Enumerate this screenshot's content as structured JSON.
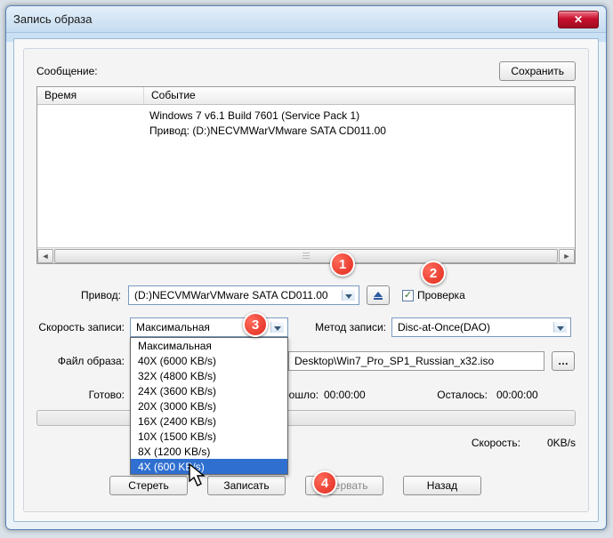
{
  "window": {
    "title": "Запись образа"
  },
  "labels": {
    "message": "Сообщение:",
    "drive": "Привод:",
    "speed": "Скорость записи:",
    "method": "Метод записи:",
    "image_file": "Файл образа:",
    "ready": "Готово:",
    "elapsed": "рошло:",
    "remaining": "Осталось:",
    "speed_stat": "Скорость:",
    "verify": "Проверка"
  },
  "buttons": {
    "save": "Сохранить",
    "erase": "Стереть",
    "burn": "Записать",
    "abort": "Прервать",
    "back": "Назад"
  },
  "columns": {
    "time": "Время",
    "event": "Событие"
  },
  "events": [
    "Windows 7 v6.1 Build 7601 (Service Pack 1)",
    "Привод: (D:)NECVMWarVMware SATA CD011.00"
  ],
  "drive_value": "(D:)NECVMWarVMware SATA CD011.00",
  "speed_value": "Максимальная",
  "method_value": "Disc-at-Once(DAO)",
  "image_value": "Desktop\\Win7_Pro_SP1_Russian_x32.iso",
  "elapsed_value": "00:00:00",
  "remaining_value": "00:00:00",
  "speed_stat_value": "0KB/s",
  "speed_options": [
    "Максимальная",
    "40X (6000 KB/s)",
    "32X (4800 KB/s)",
    "24X (3600 KB/s)",
    "20X (3000 KB/s)",
    "16X (2400 KB/s)",
    "10X (1500 KB/s)",
    "8X (1200 KB/s)",
    "4X (600 KB/s)"
  ],
  "markers": {
    "m1": "1",
    "m2": "2",
    "m3": "3",
    "m4": "4"
  }
}
